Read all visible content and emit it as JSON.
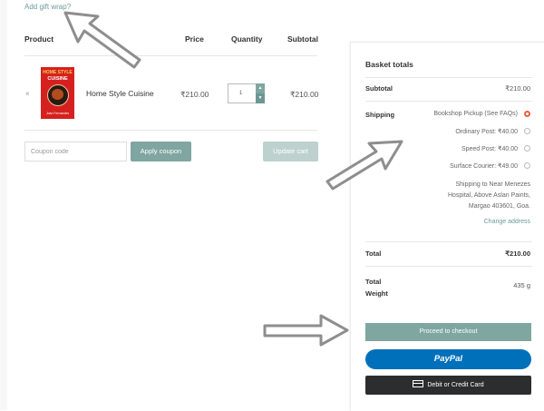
{
  "gift_link": "Add gift wrap?",
  "cart": {
    "headers": {
      "product": "Product",
      "price": "Price",
      "quantity": "Quantity",
      "subtotal": "Subtotal"
    },
    "item": {
      "remove": "×",
      "cover_title_line1": "HOME STYLE",
      "cover_title_line2": "CUISINE",
      "cover_author": "Joan Fernandes",
      "name": "Home Style Cuisine",
      "price": "₹210.00",
      "quantity": "1",
      "subtotal": "₹210.00"
    },
    "coupon_placeholder": "Coupon code",
    "apply_coupon": "Apply coupon",
    "update_cart": "Update cart"
  },
  "totals": {
    "title": "Basket totals",
    "subtotal_label": "Subtotal",
    "subtotal_value": "₹210.00",
    "shipping_label": "Shipping",
    "shipping_options": [
      {
        "label": "Bookshop Pickup (See FAQs)",
        "selected": true
      },
      {
        "label": "Ordinary Post: ₹40.00",
        "selected": false
      },
      {
        "label": "Speed Post: ₹40.00",
        "selected": false
      },
      {
        "label": "Surface Courier: ₹49.00",
        "selected": false
      }
    ],
    "shipping_to_line1": "Shipping to Near Menezes",
    "shipping_to_line2": "Hospital, Above Aslan Paints,",
    "shipping_to_line3": "Margao 403601, Goa.",
    "change_address": "Change address",
    "total_label": "Total",
    "total_value": "₹210.00",
    "weight_label_line1": "Total",
    "weight_label_line2": "Weight",
    "weight_value": "435 g",
    "checkout": "Proceed to checkout",
    "paypal": "PayPal",
    "card": "Debit or Credit Card"
  },
  "colors": {
    "accent": "#7fa6a1",
    "paypal": "#0070ba",
    "card": "#2b2d2f",
    "radio_selected": "#e8603c",
    "annotation_arrow": "#8e8e8e"
  }
}
